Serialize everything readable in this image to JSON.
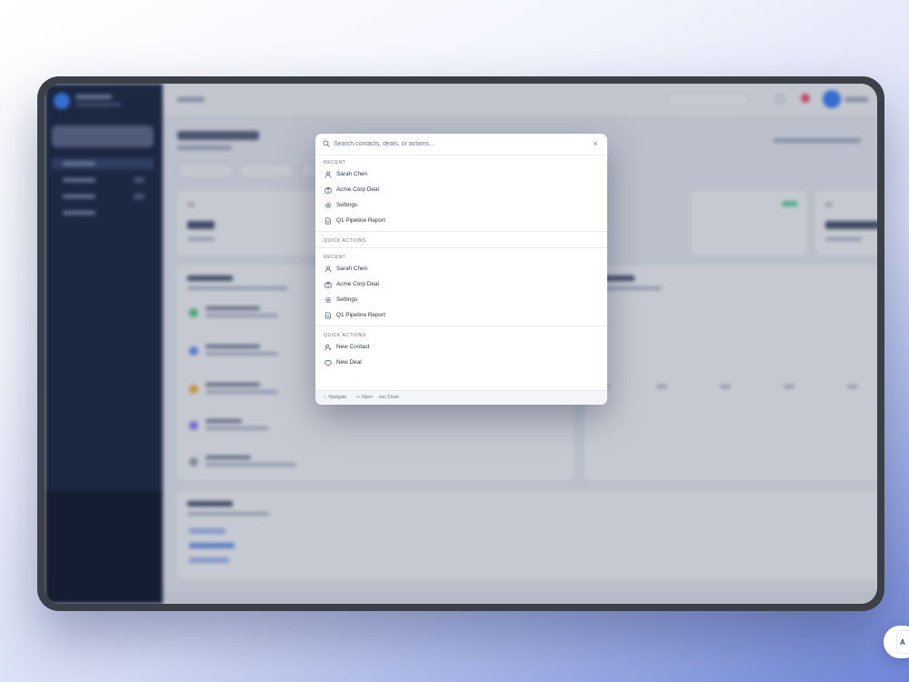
{
  "palette": {
    "placeholder": "Search contacts, deals, or actions...",
    "close_glyph": "×",
    "sections": [
      {
        "title": "RECENT",
        "items": [
          {
            "label": "Sarah Chen",
            "icon": "user-icon"
          },
          {
            "label": "Acme Corp Deal",
            "icon": "briefcase-icon"
          },
          {
            "label": "Settings",
            "icon": "gear-icon"
          },
          {
            "label": "Q1 Pipeline Report",
            "icon": "document-icon"
          }
        ]
      },
      {
        "title": "QUICK ACTIONS",
        "items": []
      },
      {
        "title": "RECENT",
        "items": [
          {
            "label": "Sarah Chen",
            "icon": "user-icon"
          },
          {
            "label": "Acme Corp Deal",
            "icon": "briefcase-icon"
          },
          {
            "label": "Settings",
            "icon": "gear-icon"
          },
          {
            "label": "Q1 Pipeline Report",
            "icon": "document-icon"
          }
        ]
      },
      {
        "title": "QUICK ACTIONS",
        "items": [
          {
            "label": "New Contact",
            "icon": "user-plus-icon"
          },
          {
            "label": "New Deal",
            "icon": "deal-icon"
          }
        ]
      }
    ],
    "footer": {
      "navigate": "↑↓ Navigate",
      "open": "↵ Open",
      "close": "esc Close"
    }
  },
  "colors": {
    "accent": "#3b82f6",
    "sidebar": "#1b2742",
    "notification": "#ef4f6b",
    "success": "#5fd49a"
  }
}
